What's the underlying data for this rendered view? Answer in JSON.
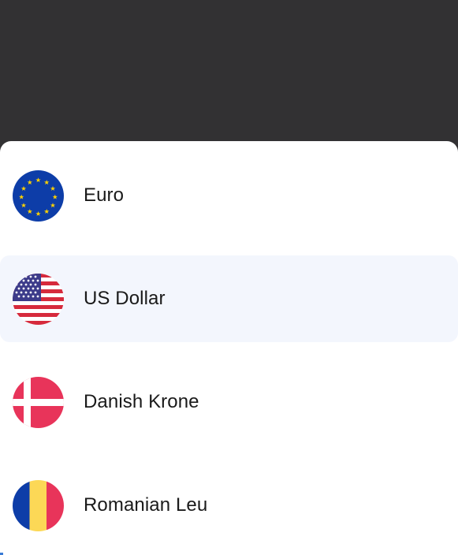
{
  "currency_picker": {
    "items": [
      {
        "label": "Euro",
        "flag": "eu-flag-icon",
        "selected": false
      },
      {
        "label": "US Dollar",
        "flag": "us-flag-icon",
        "selected": true
      },
      {
        "label": "Danish Krone",
        "flag": "denmark-flag-icon",
        "selected": false
      },
      {
        "label": "Romanian Leu",
        "flag": "romania-flag-icon",
        "selected": false
      }
    ]
  },
  "colors": {
    "backdrop": "#323133",
    "sheet": "#ffffff",
    "selected_row": "#f3f6fd",
    "text": "#1a1a1a"
  }
}
